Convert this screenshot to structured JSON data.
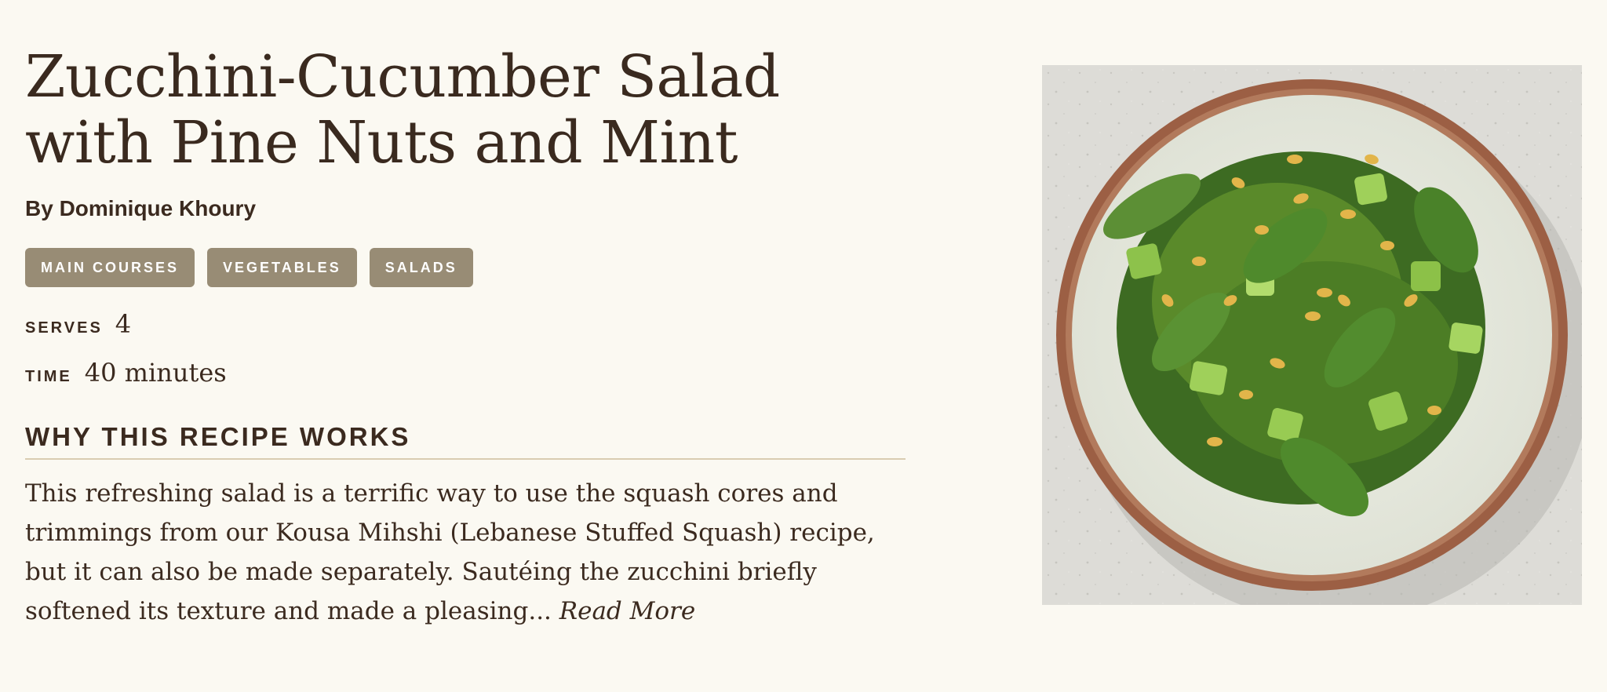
{
  "recipe": {
    "title_line1": "Zucchini-Cucumber Salad",
    "title_line2": "with Pine Nuts and Mint",
    "author": "By Dominique Khoury",
    "tags": [
      "MAIN COURSES",
      "VEGETABLES",
      "SALADS"
    ],
    "serves_label": "SERVES",
    "serves_value": "4",
    "time_label": "TIME",
    "time_value": "40 minutes",
    "why_heading": "WHY THIS RECIPE WORKS",
    "why_text": "This refreshing salad is a terrific way to use the squash cores and trimmings from our Kousa Mihshi (Lebanese Stuffed Squash) recipe, but it can also be made separately. Sautéing the zucchini briefly softened its texture and made a pleasing...",
    "read_more": "Read More"
  },
  "image": {
    "alt": "Bowl of zucchini-cucumber salad with pine nuts and mint leaves"
  },
  "colors": {
    "background": "#fbf9f2",
    "text": "#3b2a1f",
    "tag_bg": "#988c75",
    "divider": "#d9ccb1"
  }
}
